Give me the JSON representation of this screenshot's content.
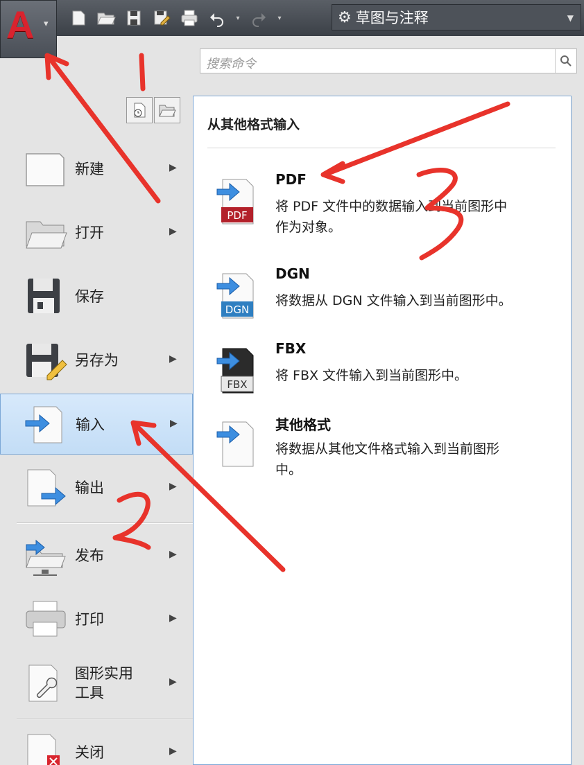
{
  "app": {
    "logo_letter": "A"
  },
  "workspace": {
    "label": "草图与注释"
  },
  "search": {
    "placeholder": "搜索命令"
  },
  "menu_items": [
    {
      "label": "新建"
    },
    {
      "label": "打开"
    },
    {
      "label": "保存"
    },
    {
      "label": "另存为"
    },
    {
      "label": "输入"
    },
    {
      "label": "输出"
    },
    {
      "label": "发布"
    },
    {
      "label": "打印"
    },
    {
      "label_line1": "图形实用",
      "label_line2": "工具"
    },
    {
      "label": "关闭"
    }
  ],
  "panel": {
    "title": "从其他格式输入",
    "entries": [
      {
        "title": "PDF",
        "desc_line1": "将 PDF 文件中的数据输入到当前图形中",
        "desc_line2": "作为对象。",
        "badge": "PDF",
        "badge_color": "#b3202a"
      },
      {
        "title": "DGN",
        "desc_line1": "将数据从 DGN 文件输入到当前图形中。",
        "badge": "DGN",
        "badge_color": "#2f7fc1"
      },
      {
        "title": "FBX",
        "desc_line1": "将 FBX 文件输入到当前图形中。",
        "badge": "FBX",
        "badge_color": "#2b2b2b"
      },
      {
        "title": "其他格式",
        "desc_line1": "将数据从其他文件格式输入到当前图形",
        "desc_line2": "中。"
      }
    ]
  },
  "annotations": {
    "n1": "1",
    "n2": "2",
    "n3": "3",
    "color": "#e8332b"
  }
}
